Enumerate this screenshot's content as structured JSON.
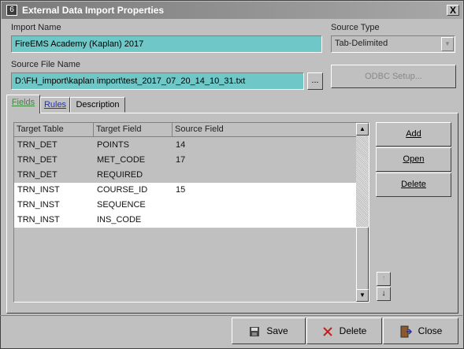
{
  "window": {
    "title": "External Data Import Properties",
    "close_glyph": "X",
    "app_icon_glyph": "6"
  },
  "import_name": {
    "label": "Import Name",
    "value": "FireEMS Academy (Kaplan) 2017"
  },
  "source_type": {
    "label": "Source Type",
    "value": "Tab-Delimited"
  },
  "source_file": {
    "label": "Source File Name",
    "value": "D:\\FH_import\\kaplan import\\test_2017_07_20_14_10_31.txt",
    "browse_label": "..."
  },
  "odbc_setup": {
    "label": "ODBC Setup..."
  },
  "tabs": [
    {
      "label": "Fields"
    },
    {
      "label": "Rules"
    },
    {
      "label": "Description"
    }
  ],
  "grid": {
    "headers": [
      "Target Table",
      "Target Field",
      "Source Field"
    ],
    "rows": [
      {
        "table": "TRN_DET",
        "field": "POINTS",
        "source": "14",
        "selected": false
      },
      {
        "table": "TRN_DET",
        "field": "MET_CODE",
        "source": "17",
        "selected": false
      },
      {
        "table": "TRN_DET",
        "field": "REQUIRED",
        "source": "",
        "selected": false
      },
      {
        "table": "TRN_INST",
        "field": "COURSE_ID",
        "source": "15",
        "selected": true
      },
      {
        "table": "TRN_INST",
        "field": "SEQUENCE",
        "source": "",
        "selected": true
      },
      {
        "table": "TRN_INST",
        "field": "INS_CODE",
        "source": "",
        "selected": true
      }
    ]
  },
  "side_buttons": {
    "add": "Add",
    "open": "Open",
    "delete": "Delete"
  },
  "footer": {
    "save": "Save",
    "delete": "Delete",
    "close": "Close"
  },
  "colors": {
    "teal_field": "#6fc7c7",
    "titlebar": "#8a8a8a",
    "face": "#c0c0c0"
  }
}
